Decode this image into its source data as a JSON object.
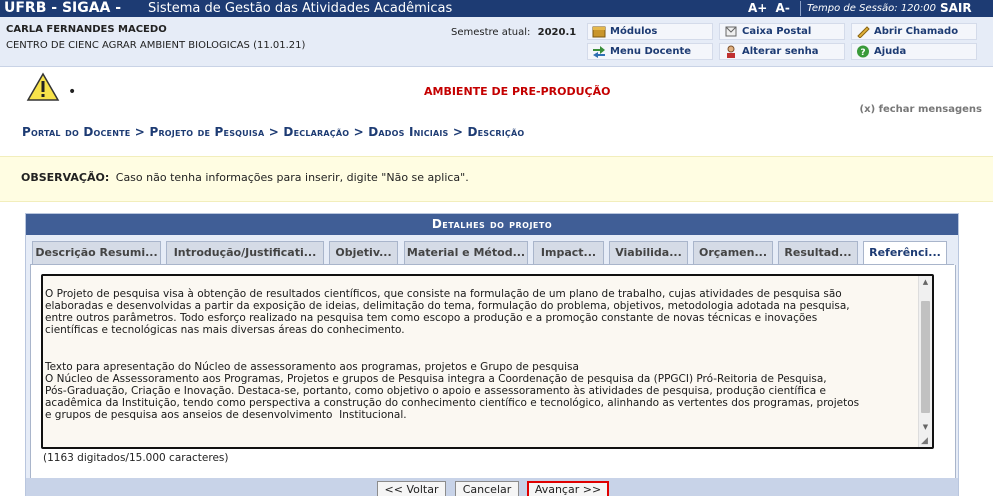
{
  "topbar": {
    "brand": "UFRB - SIGAA -",
    "system_name": "Sistema de Gestão das Atividades Acadêmicas",
    "font_increase": "A+",
    "font_decrease": "A-",
    "session_label": "Tempo de Sessão:",
    "session_time": "120:00",
    "logout": "SAIR"
  },
  "user": {
    "name": "CARLA FERNANDES MACEDO",
    "unit": "CENTRO DE CIENC AGRAR AMBIENT BIOLOGICAS (11.01.21)",
    "semester_label": "Semestre atual:",
    "semester_value": "2020.1"
  },
  "menu": {
    "modulos": "Módulos",
    "caixa_postal": "Caixa Postal",
    "abrir_chamado": "Abrir Chamado",
    "menu_docente": "Menu Docente",
    "alterar_senha": "Alterar senha",
    "ajuda": "Ajuda"
  },
  "warning": {
    "bullet": "•",
    "environment": "AMBIENTE DE PRE-PRODUÇÃO",
    "close_messages": "(x) fechar mensagens"
  },
  "breadcrumb": "Portal do Docente > Projeto de Pesquisa > Declaração > Dados Iniciais > Descrição",
  "observation": {
    "label": "OBSERVAÇÃO:",
    "text": "Caso não tenha informações para inserir, digite \"Não se aplica\"."
  },
  "panel": {
    "title": "Detalhes do projeto",
    "tabs": [
      "Descrição Resumi...",
      "Introdução/Justificati...",
      "Objetiv...",
      "Material e Métod...",
      "Impact...",
      "Viabilida...",
      "Orçamen...",
      "Resultad...",
      "Referênci..."
    ],
    "active_tab_index": 8,
    "textarea_text": "\nO Projeto de pesquisa visa à obtenção de resultados científicos, que consiste na formulação de um plano de trabalho, cujas atividades de pesquisa são\nelaboradas e desenvolvidas a partir da exposição de ideias, delimitação do tema, formulação do problema, objetivos, metodologia adotada na pesquisa,\nentre outros parâmetros. Todo esforço realizado na pesquisa tem como escopo a produção e a promoção constante de novas técnicas e inovações\ncientíficas e tecnológicas nas mais diversas áreas do conhecimento.\n\n\nTexto para apresentação do Núcleo de assessoramento aos programas, projetos e Grupo de pesquisa\nO Núcleo de Assessoramento aos Programas, Projetos e grupos de Pesquisa integra a Coordenação de pesquisa da (PPGCI) Pró-Reitoria de Pesquisa,\nPós-Graduação, Criação e Inovação. Destaca-se, portanto, como objetivo o apoio e assessoramento às atividades de pesquisa, produção científica e\nacadêmica da Instituição, tendo como perspectiva a construção do conhecimento científico e tecnológico, alinhando as vertentes dos programas, projetos\ne grupos de pesquisa aos anseios de desenvolvimento  Institucional.",
    "counter": "(1163 digitados/15.000 caracteres)"
  },
  "buttons": {
    "back": "<< Voltar",
    "cancel": "Cancelar",
    "next": "Avançar >>"
  },
  "colors": {
    "header_blue": "#1d3b73",
    "panel_title": "#405e96",
    "environment_red": "#c40000",
    "highlight_red": "#e00000",
    "observation_bg": "#fffde2"
  }
}
